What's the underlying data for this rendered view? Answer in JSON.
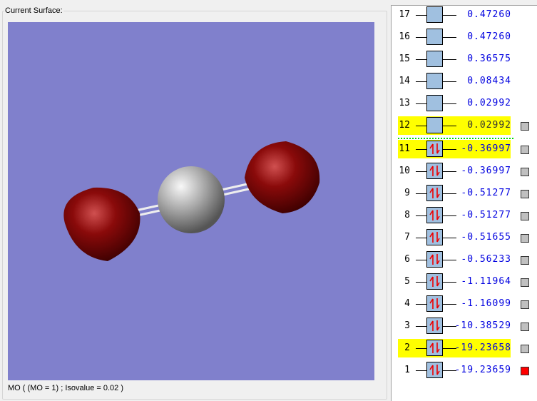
{
  "surface_label": "Current Surface:",
  "status": "MO ( (MO = 1) ; Isovalue = 0.02 )",
  "colors": {
    "canvas": "#8080cc",
    "highlight": "#ffff00",
    "value": "#0000e0",
    "selected": "#ff0000"
  },
  "orbitals": [
    {
      "n": "17",
      "energy": "0.47260",
      "occupied": false,
      "highlight": false,
      "marker": "none"
    },
    {
      "n": "16",
      "energy": "0.47260",
      "occupied": false,
      "highlight": false,
      "marker": "none"
    },
    {
      "n": "15",
      "energy": "0.36575",
      "occupied": false,
      "highlight": false,
      "marker": "none"
    },
    {
      "n": "14",
      "energy": "0.08434",
      "occupied": false,
      "highlight": false,
      "marker": "none"
    },
    {
      "n": "13",
      "energy": "0.02992",
      "occupied": false,
      "highlight": false,
      "marker": "none"
    },
    {
      "n": "12",
      "energy": "0.02992",
      "occupied": false,
      "highlight": true,
      "marker": "gray"
    },
    {
      "n": "11",
      "energy": "-0.36997",
      "occupied": true,
      "highlight": true,
      "marker": "gray"
    },
    {
      "n": "10",
      "energy": "-0.36997",
      "occupied": true,
      "highlight": false,
      "marker": "gray"
    },
    {
      "n": "9",
      "energy": "-0.51277",
      "occupied": true,
      "highlight": false,
      "marker": "gray"
    },
    {
      "n": "8",
      "energy": "-0.51277",
      "occupied": true,
      "highlight": false,
      "marker": "gray"
    },
    {
      "n": "7",
      "energy": "-0.51655",
      "occupied": true,
      "highlight": false,
      "marker": "gray"
    },
    {
      "n": "6",
      "energy": "-0.56233",
      "occupied": true,
      "highlight": false,
      "marker": "gray"
    },
    {
      "n": "5",
      "energy": "-1.11964",
      "occupied": true,
      "highlight": false,
      "marker": "gray"
    },
    {
      "n": "4",
      "energy": "-1.16099",
      "occupied": true,
      "highlight": false,
      "marker": "gray"
    },
    {
      "n": "3",
      "energy": "-10.38529",
      "occupied": true,
      "highlight": false,
      "marker": "gray"
    },
    {
      "n": "2",
      "energy": "-19.23658",
      "occupied": true,
      "highlight": true,
      "marker": "gray"
    },
    {
      "n": "1",
      "energy": "-19.23659",
      "occupied": true,
      "highlight": false,
      "marker": "red"
    }
  ]
}
